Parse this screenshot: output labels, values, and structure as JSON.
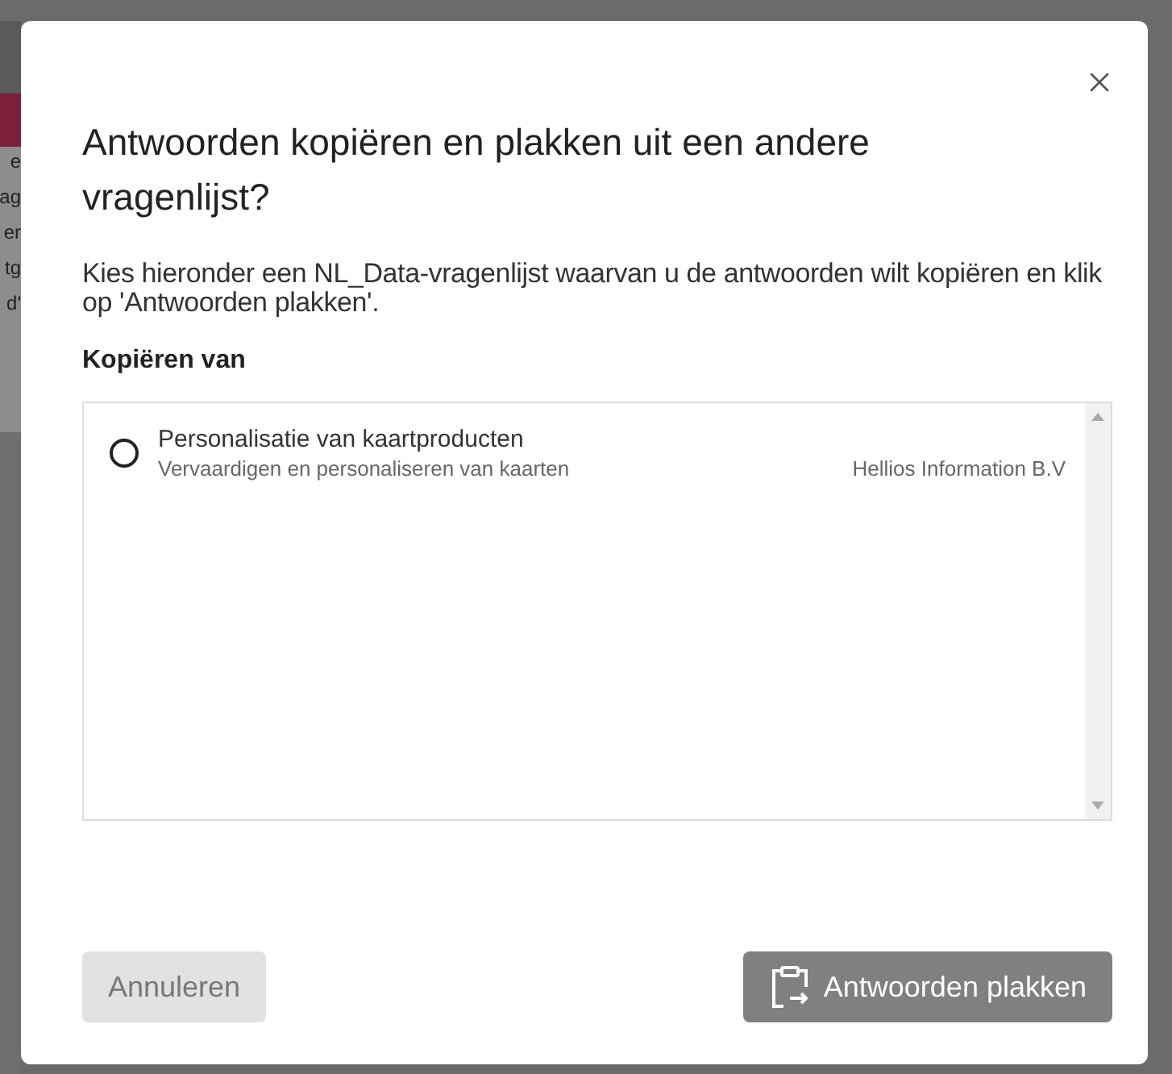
{
  "background_fragments": [
    "e",
    "ag",
    "er",
    "tg",
    "d'"
  ],
  "dialog": {
    "title": "Antwoorden kopiëren en plakken uit een andere vragenlijst?",
    "description": "Kies hieronder een NL_Data-vragenlijst waarvan u de antwoorden wilt kopiëren en klik op 'Antwoorden plakken'.",
    "source_label": "Kopiëren van",
    "options": [
      {
        "title": "Personalisatie van kaartproducten",
        "subtitle": "Vervaardigen en personaliseren van kaarten",
        "owner": "Hellios Information B.V",
        "selected": false
      }
    ],
    "buttons": [
      {
        "label": "Annuleren",
        "kind": "cancel",
        "disabled": true
      },
      {
        "label": "Antwoorden plakken",
        "kind": "paste",
        "disabled": true
      }
    ]
  }
}
